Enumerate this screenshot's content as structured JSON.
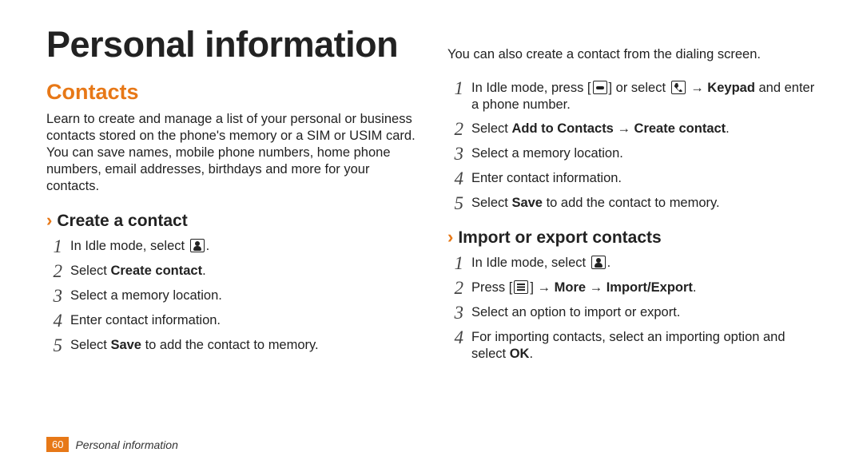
{
  "title": "Personal information",
  "section": "Contacts",
  "intro": "Learn to create and manage a list of your personal or business contacts stored on the phone's memory or a SIM or USIM card. You can save names, mobile phone numbers, home phone numbers, email addresses, birthdays and more for your contacts.",
  "sub1": "Create a contact",
  "s1_1_a": "In Idle mode, select ",
  "s1_1_b": ".",
  "s1_2_a": "Select ",
  "s1_2_b": "Create contact",
  "s1_2_c": ".",
  "s1_3": "Select a memory location.",
  "s1_4": "Enter contact information.",
  "s1_5_a": "Select ",
  "s1_5_b": "Save",
  "s1_5_c": " to add the contact to memory.",
  "intro2": "You can also create a contact from the dialing screen.",
  "d1_a": "In Idle mode, press [",
  "d1_b": "] or select ",
  "d1_c": " → ",
  "d1_d": "Keypad",
  "d1_e": " and enter a phone number.",
  "d2_a": "Select ",
  "d2_b": "Add to Contacts",
  "d2_c": " → ",
  "d2_d": "Create contact",
  "d2_e": ".",
  "d3": "Select a memory location.",
  "d4": "Enter contact information.",
  "d5_a": "Select ",
  "d5_b": "Save",
  "d5_c": " to add the contact to memory.",
  "sub2": "Import or export contacts",
  "e1_a": "In Idle mode, select ",
  "e1_b": ".",
  "e2_a": "Press [",
  "e2_b": "] → ",
  "e2_c": "More",
  "e2_d": " → ",
  "e2_e": "Import/Export",
  "e2_f": ".",
  "e3": "Select an option to import or export.",
  "e4_a": "For importing contacts, select an importing option and select ",
  "e4_b": "OK",
  "e4_c": ".",
  "footer_page": "60",
  "footer_text": "Personal information"
}
